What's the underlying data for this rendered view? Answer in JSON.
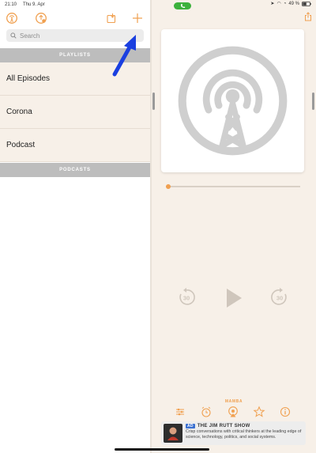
{
  "status_bar": {
    "time": "21:10",
    "date": "Thu 9. Apr",
    "battery": "49 %"
  },
  "colors": {
    "accent": "#f0a050",
    "arrow": "#1a3fe0",
    "section_header": "#bdbdbd",
    "call_pill": "#3cb13c"
  },
  "sidebar": {
    "search_placeholder": "Search",
    "playlists_header": "PLAYLISTS",
    "playlists": [
      {
        "label": "All Episodes"
      },
      {
        "label": "Corona"
      },
      {
        "label": "Podcast"
      }
    ],
    "podcasts_header": "PODCASTS",
    "toolbar_icons": [
      "overcast-icon",
      "upload-queue-icon",
      "import-icon",
      "plus-icon"
    ]
  },
  "player": {
    "skip_back_seconds": "30",
    "skip_forward_seconds": "30",
    "progress": 0,
    "bottom_label": "MAMBA",
    "bottom_icons": [
      "effects-icon",
      "sleep-timer-icon",
      "airplay-icon",
      "star-icon",
      "info-icon"
    ]
  },
  "ad": {
    "badge": "AD",
    "title": "THE JIM RUTT SHOW",
    "body": "Crisp conversations with critical thinkers at the leading edge of science, technology, politics, and social systems."
  }
}
